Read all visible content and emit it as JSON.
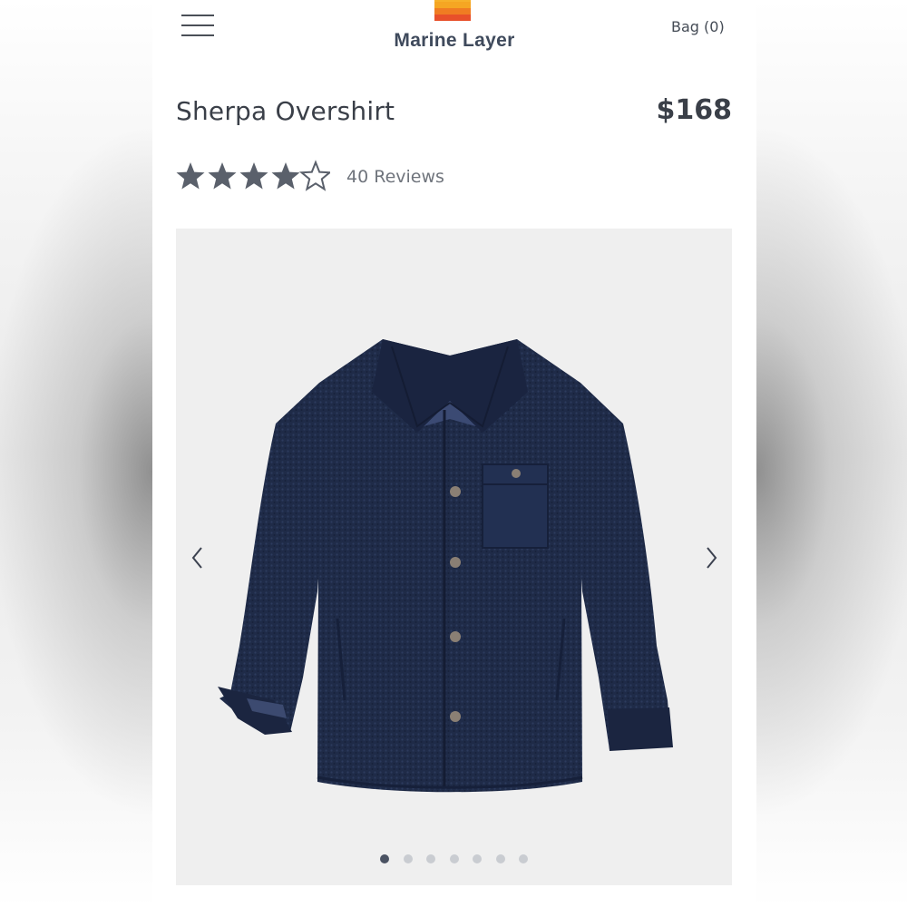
{
  "header": {
    "brand_name": "Marine Layer",
    "bag_label": "Bag (0)",
    "icons": {
      "menu": "hamburger-menu-icon",
      "logo": "sunset-stripes-logo"
    },
    "logo_colors": [
      "#f5a623",
      "#f07c22",
      "#e8502a",
      "#d6332b"
    ]
  },
  "product": {
    "title": "Sherpa Overshirt",
    "price": "$168",
    "rating": {
      "value": 4.5,
      "max": 5,
      "reviews_label": "40 Reviews",
      "star_color": "#5a606b"
    },
    "gallery": {
      "image_alt": "Navy sherpa overshirt with snap buttons and chest pocket",
      "total_images": 7,
      "active_index": 0,
      "prev_icon": "chevron-left-icon",
      "next_icon": "chevron-right-icon",
      "background_color": "#efefef",
      "garment_color": "#1f2b48"
    }
  }
}
